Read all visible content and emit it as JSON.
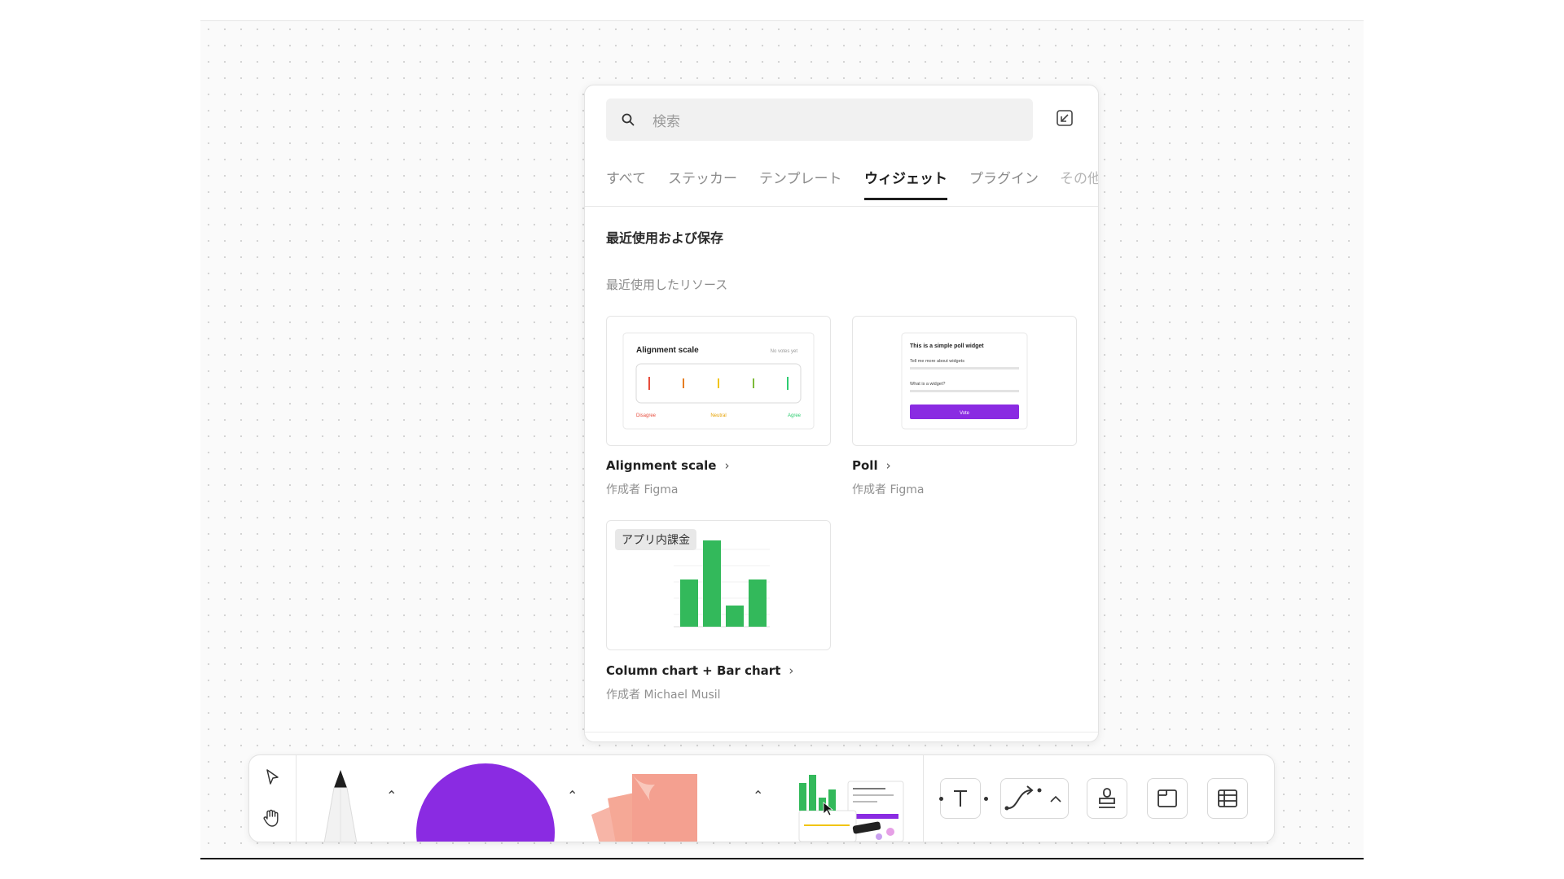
{
  "search": {
    "placeholder": "検索"
  },
  "tabs": [
    {
      "label": "すべて"
    },
    {
      "label": "ステッカー"
    },
    {
      "label": "テンプレート"
    },
    {
      "label": "ウィジェット"
    },
    {
      "label": "プラグイン"
    },
    {
      "label": "その他"
    }
  ],
  "section_title": "最近使用および保存",
  "subsection_title": "最近使用したリソース",
  "cards": [
    {
      "title": "Alignment scale",
      "author": "作成者 Figma",
      "preview": {
        "heading": "Alignment scale",
        "status": "No votes yet",
        "labels": [
          "Disagree",
          "Neutral",
          "Agree"
        ]
      }
    },
    {
      "title": "Poll",
      "author": "作成者 Figma",
      "preview": {
        "heading": "This is a simple poll widget",
        "q1": "Tell me more about widgets",
        "q2": "What is a widget?",
        "button": "Vote"
      }
    },
    {
      "title": "Column chart + Bar chart",
      "author": "作成者 Michael Musil",
      "badge": "アプリ内課金"
    }
  ],
  "toolbar": {
    "tools": [
      "select",
      "hand",
      "pen",
      "shape",
      "sticky",
      "widgets",
      "text",
      "connector",
      "stamp",
      "section",
      "table"
    ],
    "colors": {
      "shape": "#8a2be2",
      "sticky": "#f4a090",
      "accent_green": "#33b95b"
    }
  }
}
